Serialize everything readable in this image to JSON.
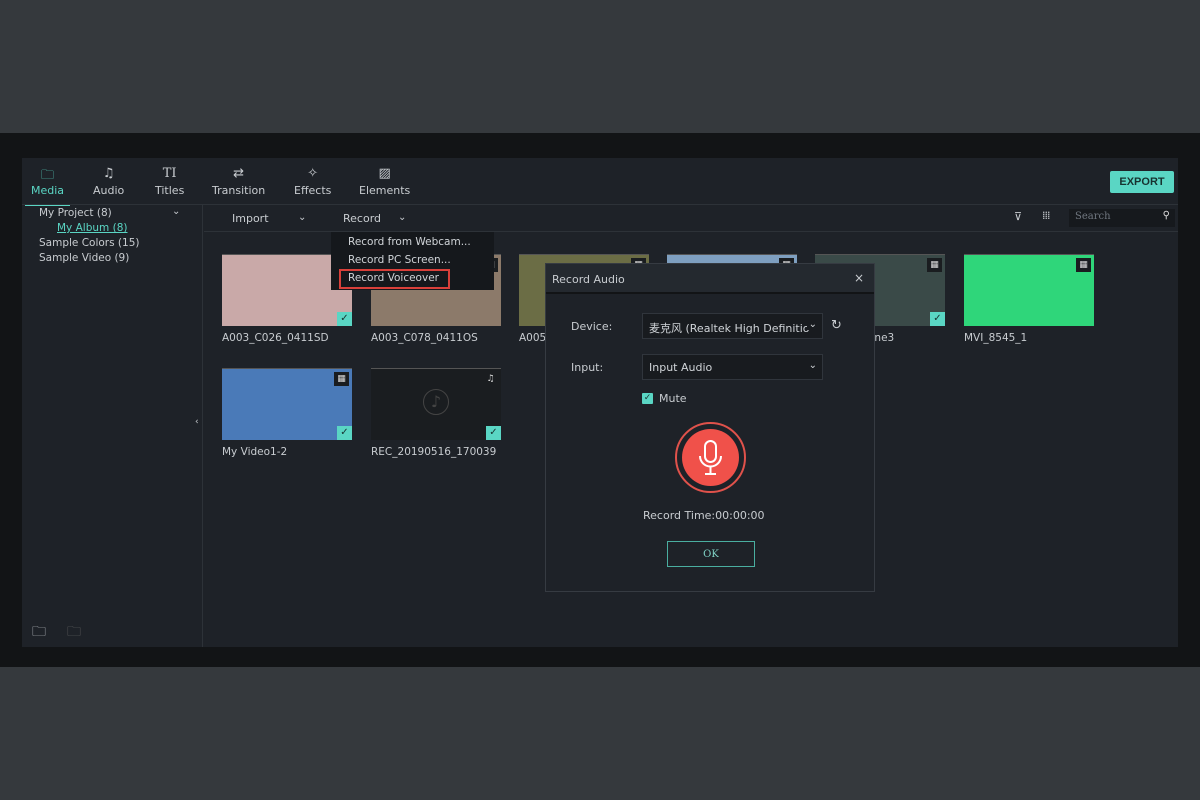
{
  "tabs": [
    {
      "label": "Media",
      "icon": "folder-icon"
    },
    {
      "label": "Audio",
      "icon": "music-note-icon"
    },
    {
      "label": "Titles",
      "icon": "text-icon"
    },
    {
      "label": "Transition",
      "icon": "transition-icon"
    },
    {
      "label": "Effects",
      "icon": "effects-icon"
    },
    {
      "label": "Elements",
      "icon": "image-icon"
    }
  ],
  "export_label": "EXPORT",
  "sidebar": {
    "project": "My Project (8)",
    "album": "My Album (8)",
    "colors": "Sample Colors (15)",
    "video": "Sample Video (9)"
  },
  "toolbar": {
    "import": "Import",
    "record": "Record",
    "search_placeholder": "Search"
  },
  "record_menu": [
    "Record from Webcam...",
    "Record PC Screen...",
    "Record Voiceover"
  ],
  "media": [
    {
      "name": "A003_C026_0411SD",
      "color": "#c9a9a8",
      "type": "video"
    },
    {
      "name": "A003_C078_0411OS",
      "color": "#8c7a6a",
      "type": "video"
    },
    {
      "name": "A005",
      "color": "#6b6d45",
      "type": "video"
    },
    {
      "name": "",
      "color": "#7e9fc0",
      "type": "video"
    },
    {
      "name": "one3",
      "color": "#3a4a48",
      "type": "video"
    },
    {
      "name": "MVI_8545_1",
      "color": "#2fd67a",
      "type": "video"
    },
    {
      "name": "My Video1-2",
      "color": "#4a7ab8",
      "type": "video"
    },
    {
      "name": "REC_20190516_170039",
      "color": "#1a1d20",
      "type": "audio"
    }
  ],
  "dialog": {
    "title": "Record Audio",
    "device_label": "Device:",
    "device_value": "麦克风 (Realtek High Definitio",
    "input_label": "Input:",
    "input_value": "Input Audio",
    "mute_label": "Mute",
    "mute_checked": true,
    "record_time_label": "Record Time:",
    "record_time": "00:00:00",
    "ok": "OK"
  },
  "colors": {
    "accent": "#5ad6c4",
    "record": "#f0514a",
    "highlight": "#d9403a"
  }
}
